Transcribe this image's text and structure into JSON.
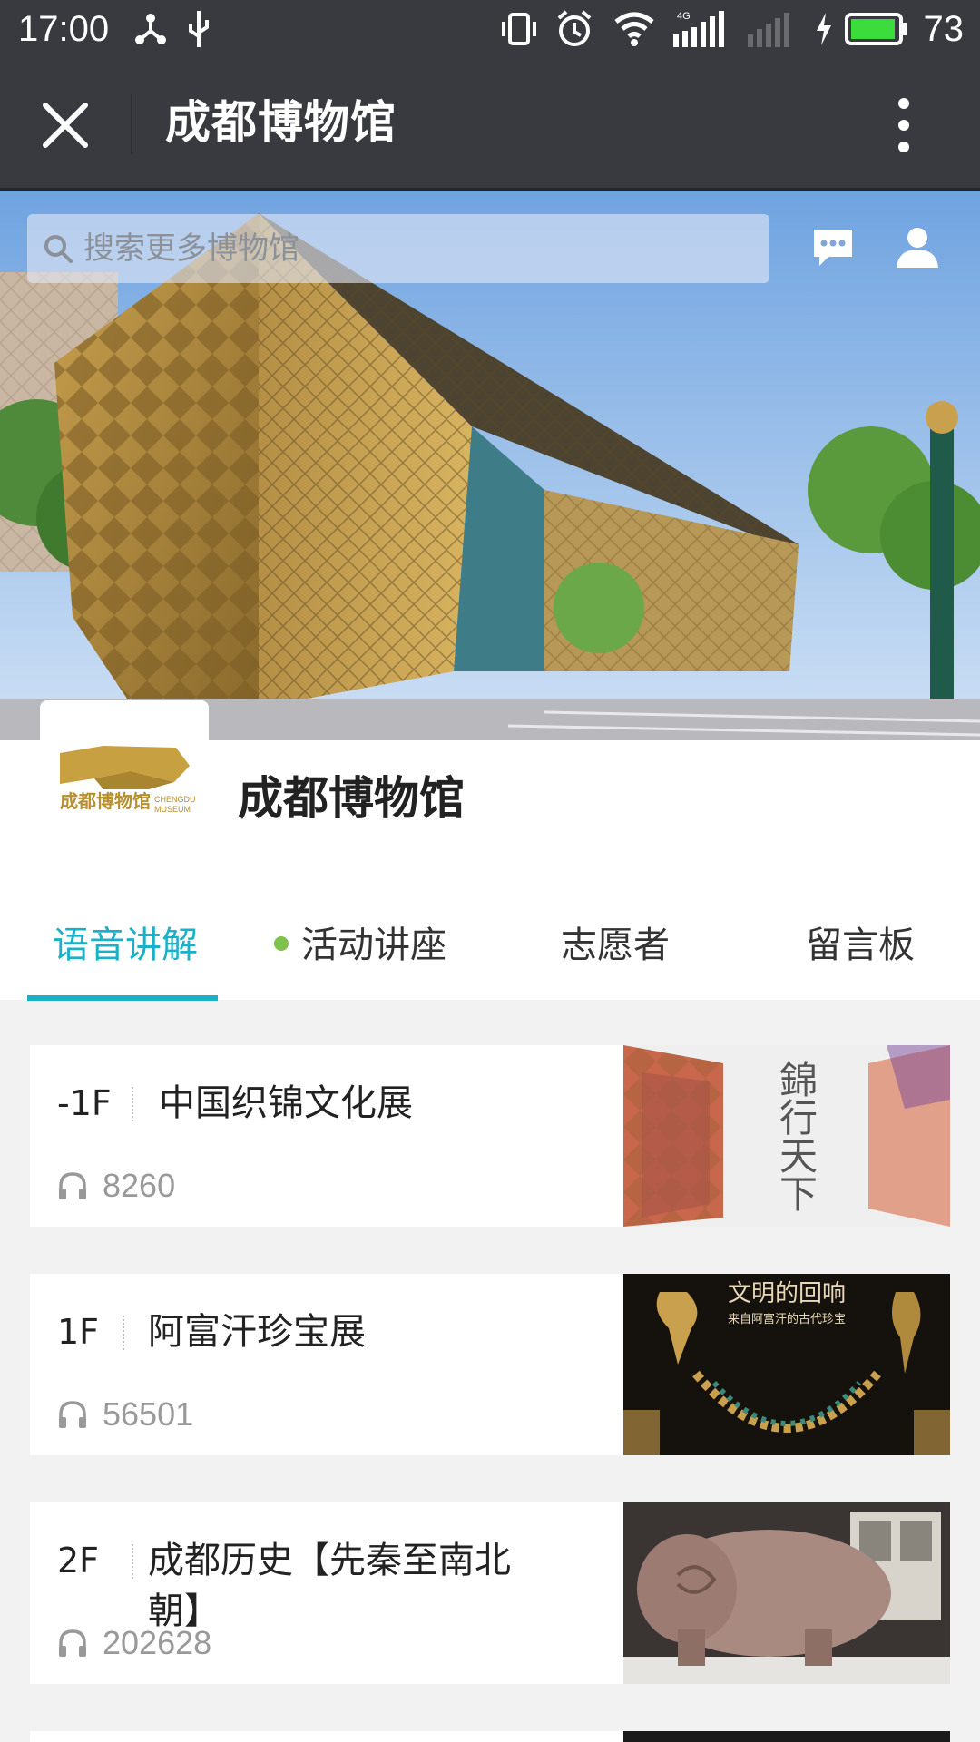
{
  "status_bar": {
    "time": "17:00",
    "battery": "73",
    "network": "4G"
  },
  "title_bar": {
    "title": "成都博物馆"
  },
  "header": {
    "search_placeholder": "搜索更多博物馆"
  },
  "museum": {
    "name": "成都博物馆",
    "logo_text": "成都博物馆",
    "logo_sub_1": "CHENGDU",
    "logo_sub_2": "MUSEUM"
  },
  "tabs": [
    {
      "label": "语音讲解",
      "active": true
    },
    {
      "label": "活动讲座",
      "has_dot": true
    },
    {
      "label": "志愿者"
    },
    {
      "label": "留言板"
    }
  ],
  "exhibits": [
    {
      "floor": "-1F",
      "title": "中国织锦文化展",
      "plays": "8260",
      "thumb_text": "錦行天下"
    },
    {
      "floor": "1F",
      "title": "阿富汗珍宝展",
      "plays": "56501",
      "thumb_text": "文明的回响",
      "thumb_sub": "来自阿富汗的古代珍宝"
    },
    {
      "floor": "2F",
      "title": "成都历史【先秦至南北朝】",
      "plays": "202628"
    }
  ],
  "colors": {
    "accent": "#1ab0c7",
    "titlebar": "#393a3f",
    "dot": "#7ec14d"
  }
}
